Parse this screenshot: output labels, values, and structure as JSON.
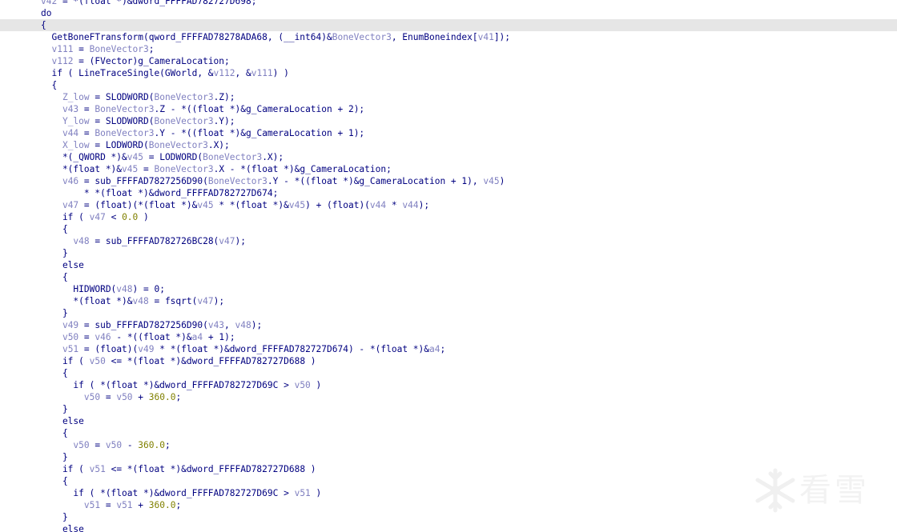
{
  "editor": {
    "lines": [
      [
        {
          "t": "v42",
          "c": "var"
        },
        {
          "t": " = *(",
          "c": "txt"
        },
        {
          "t": "float",
          "c": "txt"
        },
        {
          "t": " *)&dword_FFFFAD782727D698;",
          "c": "txt"
        }
      ],
      [
        {
          "t": "do",
          "c": "kw"
        }
      ],
      [
        {
          "t": "{",
          "c": "txt"
        }
      ],
      [
        {
          "t": "  GetBoneFTransform(qword_FFFFAD78278ADA68, (__int64)&",
          "c": "txt"
        },
        {
          "t": "BoneVector3",
          "c": "var"
        },
        {
          "t": ", EnumBoneindex[",
          "c": "txt"
        },
        {
          "t": "v41",
          "c": "var"
        },
        {
          "t": "]);",
          "c": "txt"
        }
      ],
      [
        {
          "t": "  ",
          "c": "txt"
        },
        {
          "t": "v111",
          "c": "var"
        },
        {
          "t": " = ",
          "c": "txt"
        },
        {
          "t": "BoneVector3",
          "c": "var"
        },
        {
          "t": ";",
          "c": "txt"
        }
      ],
      [
        {
          "t": "  ",
          "c": "txt"
        },
        {
          "t": "v112",
          "c": "var"
        },
        {
          "t": " = (FVector)g_CameraLocation;",
          "c": "txt"
        }
      ],
      [
        {
          "t": "  if ( LineTraceSingle(GWorld, &",
          "c": "txt"
        },
        {
          "t": "v112",
          "c": "var"
        },
        {
          "t": ", &",
          "c": "txt"
        },
        {
          "t": "v111",
          "c": "var"
        },
        {
          "t": ") )",
          "c": "txt"
        }
      ],
      [
        {
          "t": "  {",
          "c": "txt"
        }
      ],
      [
        {
          "t": "    ",
          "c": "txt"
        },
        {
          "t": "Z_low",
          "c": "var"
        },
        {
          "t": " = SLODWORD(",
          "c": "txt"
        },
        {
          "t": "BoneVector3",
          "c": "var"
        },
        {
          "t": ".Z);",
          "c": "txt"
        }
      ],
      [
        {
          "t": "    ",
          "c": "txt"
        },
        {
          "t": "v43",
          "c": "var"
        },
        {
          "t": " = ",
          "c": "txt"
        },
        {
          "t": "BoneVector3",
          "c": "var"
        },
        {
          "t": ".Z - *((float *)&g_CameraLocation + 2);",
          "c": "txt"
        }
      ],
      [
        {
          "t": "    ",
          "c": "txt"
        },
        {
          "t": "Y_low",
          "c": "var"
        },
        {
          "t": " = SLODWORD(",
          "c": "txt"
        },
        {
          "t": "BoneVector3",
          "c": "var"
        },
        {
          "t": ".Y);",
          "c": "txt"
        }
      ],
      [
        {
          "t": "    ",
          "c": "txt"
        },
        {
          "t": "v44",
          "c": "var"
        },
        {
          "t": " = ",
          "c": "txt"
        },
        {
          "t": "BoneVector3",
          "c": "var"
        },
        {
          "t": ".Y - *((float *)&g_CameraLocation + 1);",
          "c": "txt"
        }
      ],
      [
        {
          "t": "    ",
          "c": "txt"
        },
        {
          "t": "X_low",
          "c": "var"
        },
        {
          "t": " = LODWORD(",
          "c": "txt"
        },
        {
          "t": "BoneVector3",
          "c": "var"
        },
        {
          "t": ".X);",
          "c": "txt"
        }
      ],
      [
        {
          "t": "    *(_QWORD *)&",
          "c": "txt"
        },
        {
          "t": "v45",
          "c": "var"
        },
        {
          "t": " = LODWORD(",
          "c": "txt"
        },
        {
          "t": "BoneVector3",
          "c": "var"
        },
        {
          "t": ".X);",
          "c": "txt"
        }
      ],
      [
        {
          "t": "    *(float *)&",
          "c": "txt"
        },
        {
          "t": "v45",
          "c": "var"
        },
        {
          "t": " = ",
          "c": "txt"
        },
        {
          "t": "BoneVector3",
          "c": "var"
        },
        {
          "t": ".X - *(float *)&g_CameraLocation;",
          "c": "txt"
        }
      ],
      [
        {
          "t": "    ",
          "c": "txt"
        },
        {
          "t": "v46",
          "c": "var"
        },
        {
          "t": " = sub_FFFFAD7827256D90(",
          "c": "txt"
        },
        {
          "t": "BoneVector3",
          "c": "var"
        },
        {
          "t": ".Y - *((float *)&g_CameraLocation + 1), ",
          "c": "txt"
        },
        {
          "t": "v45",
          "c": "var"
        },
        {
          "t": ")",
          "c": "txt"
        }
      ],
      [
        {
          "t": "        * *(float *)&dword_FFFFAD782727D674;",
          "c": "txt"
        }
      ],
      [
        {
          "t": "    ",
          "c": "txt"
        },
        {
          "t": "v47",
          "c": "var"
        },
        {
          "t": " = (float)(*(float *)&",
          "c": "txt"
        },
        {
          "t": "v45",
          "c": "var"
        },
        {
          "t": " * *(float *)&",
          "c": "txt"
        },
        {
          "t": "v45",
          "c": "var"
        },
        {
          "t": ") + (float)(",
          "c": "txt"
        },
        {
          "t": "v44",
          "c": "var"
        },
        {
          "t": " * ",
          "c": "txt"
        },
        {
          "t": "v44",
          "c": "var"
        },
        {
          "t": ");",
          "c": "txt"
        }
      ],
      [
        {
          "t": "    if ( ",
          "c": "txt"
        },
        {
          "t": "v47",
          "c": "var"
        },
        {
          "t": " < ",
          "c": "txt"
        },
        {
          "t": "0.0",
          "c": "num"
        },
        {
          "t": " )",
          "c": "txt"
        }
      ],
      [
        {
          "t": "    {",
          "c": "txt"
        }
      ],
      [
        {
          "t": "      ",
          "c": "txt"
        },
        {
          "t": "v48",
          "c": "var"
        },
        {
          "t": " = sub_FFFFAD782726BC28(",
          "c": "txt"
        },
        {
          "t": "v47",
          "c": "var"
        },
        {
          "t": ");",
          "c": "txt"
        }
      ],
      [
        {
          "t": "    }",
          "c": "txt"
        }
      ],
      [
        {
          "t": "    else",
          "c": "txt"
        }
      ],
      [
        {
          "t": "    {",
          "c": "txt"
        }
      ],
      [
        {
          "t": "      HIDWORD(",
          "c": "txt"
        },
        {
          "t": "v48",
          "c": "var"
        },
        {
          "t": ") = 0;",
          "c": "txt"
        }
      ],
      [
        {
          "t": "      *(float *)&",
          "c": "txt"
        },
        {
          "t": "v48",
          "c": "var"
        },
        {
          "t": " = fsqrt(",
          "c": "txt"
        },
        {
          "t": "v47",
          "c": "var"
        },
        {
          "t": ");",
          "c": "txt"
        }
      ],
      [
        {
          "t": "    }",
          "c": "txt"
        }
      ],
      [
        {
          "t": "    ",
          "c": "txt"
        },
        {
          "t": "v49",
          "c": "var"
        },
        {
          "t": " = sub_FFFFAD7827256D90(",
          "c": "txt"
        },
        {
          "t": "v43",
          "c": "var"
        },
        {
          "t": ", ",
          "c": "txt"
        },
        {
          "t": "v48",
          "c": "var"
        },
        {
          "t": ");",
          "c": "txt"
        }
      ],
      [
        {
          "t": "    ",
          "c": "txt"
        },
        {
          "t": "v50",
          "c": "var"
        },
        {
          "t": " = ",
          "c": "txt"
        },
        {
          "t": "v46",
          "c": "var"
        },
        {
          "t": " - *((float *)&",
          "c": "txt"
        },
        {
          "t": "a4",
          "c": "var"
        },
        {
          "t": " + 1);",
          "c": "txt"
        }
      ],
      [
        {
          "t": "    ",
          "c": "txt"
        },
        {
          "t": "v51",
          "c": "var"
        },
        {
          "t": " = (float)(",
          "c": "txt"
        },
        {
          "t": "v49",
          "c": "var"
        },
        {
          "t": " * *(float *)&dword_FFFFAD782727D674) - *(float *)&",
          "c": "txt"
        },
        {
          "t": "a4",
          "c": "var"
        },
        {
          "t": ";",
          "c": "txt"
        }
      ],
      [
        {
          "t": "    if ( ",
          "c": "txt"
        },
        {
          "t": "v50",
          "c": "var"
        },
        {
          "t": " <= *(float *)&dword_FFFFAD782727D688 )",
          "c": "txt"
        }
      ],
      [
        {
          "t": "    {",
          "c": "txt"
        }
      ],
      [
        {
          "t": "      if ( *(float *)&dword_FFFFAD782727D69C > ",
          "c": "txt"
        },
        {
          "t": "v50",
          "c": "var"
        },
        {
          "t": " )",
          "c": "txt"
        }
      ],
      [
        {
          "t": "        ",
          "c": "txt"
        },
        {
          "t": "v50",
          "c": "var"
        },
        {
          "t": " = ",
          "c": "txt"
        },
        {
          "t": "v50",
          "c": "var"
        },
        {
          "t": " + ",
          "c": "txt"
        },
        {
          "t": "360.0",
          "c": "num"
        },
        {
          "t": ";",
          "c": "txt"
        }
      ],
      [
        {
          "t": "    }",
          "c": "txt"
        }
      ],
      [
        {
          "t": "    else",
          "c": "txt"
        }
      ],
      [
        {
          "t": "    {",
          "c": "txt"
        }
      ],
      [
        {
          "t": "      ",
          "c": "txt"
        },
        {
          "t": "v50",
          "c": "var"
        },
        {
          "t": " = ",
          "c": "txt"
        },
        {
          "t": "v50",
          "c": "var"
        },
        {
          "t": " - ",
          "c": "txt"
        },
        {
          "t": "360.0",
          "c": "num"
        },
        {
          "t": ";",
          "c": "txt"
        }
      ],
      [
        {
          "t": "    }",
          "c": "txt"
        }
      ],
      [
        {
          "t": "    if ( ",
          "c": "txt"
        },
        {
          "t": "v51",
          "c": "var"
        },
        {
          "t": " <= *(float *)&dword_FFFFAD782727D688 )",
          "c": "txt"
        }
      ],
      [
        {
          "t": "    {",
          "c": "txt"
        }
      ],
      [
        {
          "t": "      if ( *(float *)&dword_FFFFAD782727D69C > ",
          "c": "txt"
        },
        {
          "t": "v51",
          "c": "var"
        },
        {
          "t": " )",
          "c": "txt"
        }
      ],
      [
        {
          "t": "        ",
          "c": "txt"
        },
        {
          "t": "v51",
          "c": "var"
        },
        {
          "t": " = ",
          "c": "txt"
        },
        {
          "t": "v51",
          "c": "var"
        },
        {
          "t": " + ",
          "c": "txt"
        },
        {
          "t": "360.0",
          "c": "num"
        },
        {
          "t": ";",
          "c": "txt"
        }
      ],
      [
        {
          "t": "    }",
          "c": "txt"
        }
      ],
      [
        {
          "t": "    else",
          "c": "txt"
        }
      ]
    ],
    "current_line_index": 2
  },
  "colors": {
    "keyword": "#000080",
    "variable": "#8080c0",
    "number": "#808000",
    "current_line_bg": "#e6e6e6",
    "background": "#ffffff"
  },
  "watermark": {
    "text": "看雪",
    "icon": "snowflake-icon"
  }
}
